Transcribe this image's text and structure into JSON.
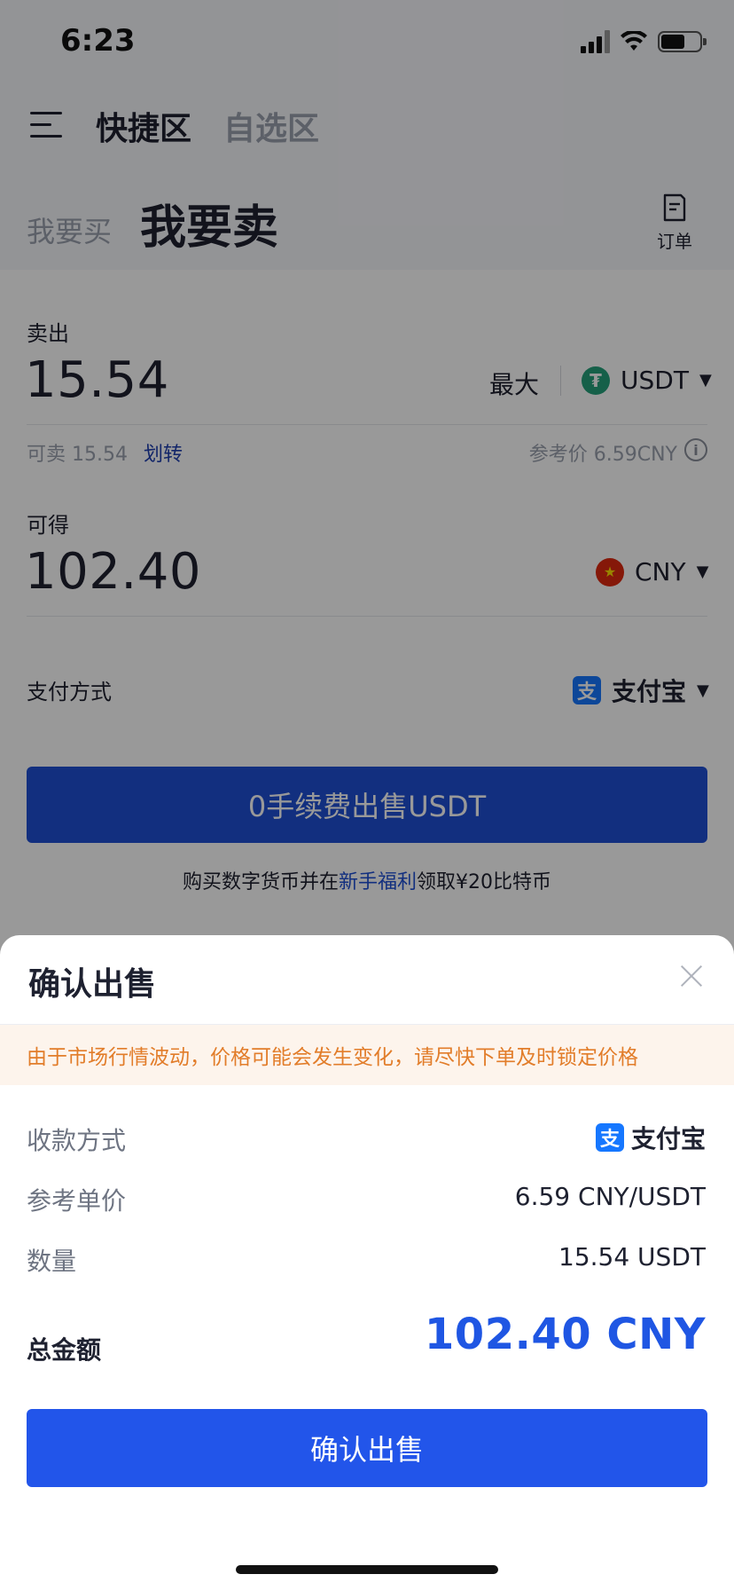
{
  "status": {
    "time": "6:23"
  },
  "nav": {
    "tabs": [
      "快捷区",
      "自选区"
    ]
  },
  "trade_tabs": {
    "buy": "我要买",
    "sell": "我要卖"
  },
  "orders": {
    "label": "订单"
  },
  "sell_section": {
    "label": "卖出",
    "amount": "15.54",
    "max_label": "最大",
    "coin": "USDT",
    "coin_glyph": "₮",
    "available": "可卖 15.54",
    "transfer": "划转",
    "ref_price": "参考价 6.59CNY",
    "info_glyph": "i"
  },
  "receive_section": {
    "label": "可得",
    "amount": "102.40",
    "currency": "CNY",
    "currency_glyph": "★"
  },
  "payment": {
    "label": "支付方式",
    "method": "支付宝",
    "icon_glyph": "支"
  },
  "sell_button": "0手续费出售USDT",
  "promo": {
    "prefix": "购买数字货币并在",
    "link": "新手福利",
    "suffix": "领取¥20比特币"
  },
  "sheet": {
    "title": "确认出售",
    "warning": "由于市场行情波动，价格可能会发生变化，请尽快下单及时锁定价格",
    "rows": [
      {
        "label": "收款方式",
        "value": "支付宝"
      },
      {
        "label": "参考单价",
        "value": "6.59 CNY/USDT"
      },
      {
        "label": "数量",
        "value": "15.54 USDT"
      }
    ],
    "total_label": "总金额",
    "total_value": "102.40 CNY",
    "confirm_button": "确认出售"
  },
  "colors": {
    "primary": "#2255ea",
    "warning_text": "#e27d2a",
    "warning_bg": "#fdf4ec",
    "usdt": "#26a17b",
    "cny": "#de2910",
    "alipay": "#1677ff"
  },
  "icons": [
    "menu-icon",
    "orders-icon",
    "info-icon",
    "usdt-icon",
    "cny-flag-icon",
    "alipay-icon",
    "close-icon",
    "caret-down-icon"
  ]
}
